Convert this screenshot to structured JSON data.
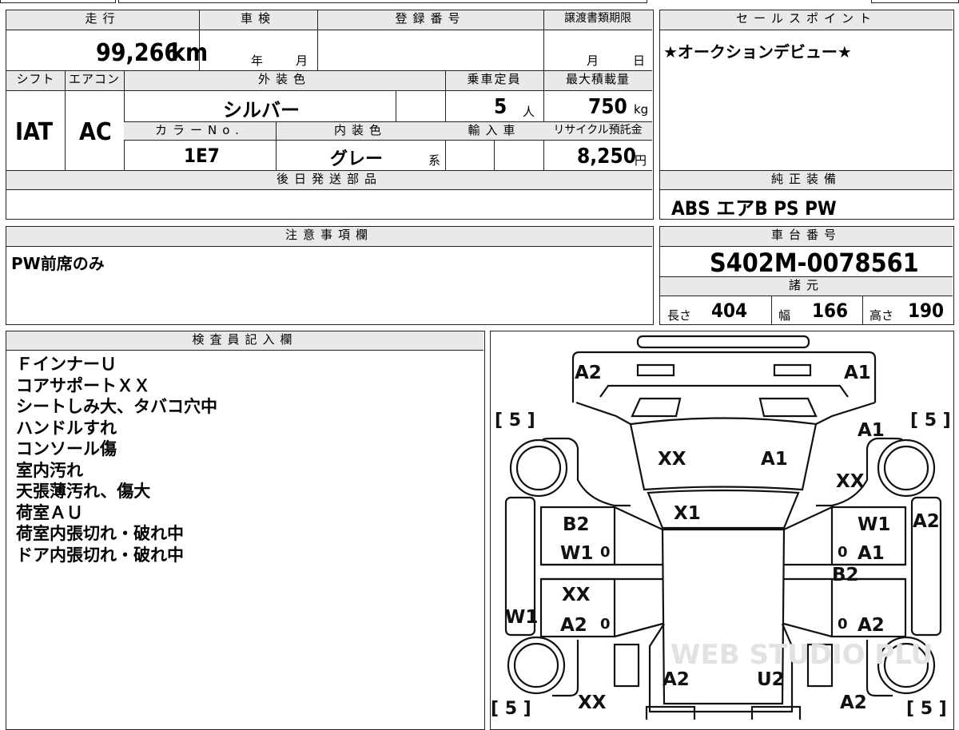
{
  "sheet": {
    "mileage": {
      "header": "走行",
      "value": "99,266",
      "unit": "km"
    },
    "shaken": {
      "header": "車検",
      "year": "年",
      "month": "月"
    },
    "reg_no": {
      "header": "登録番号",
      "value": ""
    },
    "transfer_deadline": {
      "header": "譲渡書類期限",
      "month": "月",
      "day": "日"
    },
    "shift": {
      "header": "シフト",
      "value": "IAT"
    },
    "aircon": {
      "header": "エアコン",
      "value": "AC"
    },
    "exterior_color": {
      "header": "外装色",
      "value": "シルバー"
    },
    "capacity": {
      "header": "乗車定員",
      "value": "5",
      "unit": "人"
    },
    "max_load": {
      "header": "最大積載量",
      "value": "750",
      "unit": "kg"
    },
    "color_no": {
      "header": "カラーNo.",
      "value": "1E7"
    },
    "interior_color": {
      "header": "内装色",
      "value": "グレー",
      "suffix": "系"
    },
    "imported": {
      "header": "輸入車",
      "value": ""
    },
    "recycle_fee": {
      "header": "リサイクル預託金",
      "value": "8,250",
      "unit": "円"
    },
    "later_parts": {
      "header": "後日発送部品",
      "value": ""
    }
  },
  "sales_point": {
    "header": "セールスポイント",
    "text": "★オークションデビュー★"
  },
  "equipment": {
    "header": "純正装備",
    "text": "ABS エアB PS PW"
  },
  "notes": {
    "header": "注意事項欄",
    "text": "PW前席のみ"
  },
  "chassis": {
    "header": "車台番号",
    "value": "S402M-0078561"
  },
  "specs": {
    "header": "諸元",
    "length_label": "長さ",
    "length": "404",
    "width_label": "幅",
    "width": "166",
    "height_label": "高さ",
    "height": "190"
  },
  "inspector": {
    "header": "検査員記入欄",
    "lines": [
      "ＦインナーＵ",
      "コアサポートＸＸ",
      "シートしみ大、タバコ穴中",
      "ハンドルすれ",
      "コンソール傷",
      "室内汚れ",
      "天張薄汚れ、傷大",
      "荷室ＡＵ",
      "荷室内張切れ・破れ中",
      "ドア内張切れ・破れ中"
    ]
  },
  "diagram": {
    "tires": [
      "[ 5 ]",
      "[ 5 ]",
      "[ 5 ]",
      "[ 5 ]"
    ],
    "marks": {
      "front_left": "A2",
      "front_right": "A1",
      "hood_left": "XX",
      "hood_right": "A1",
      "fender_right_top": "A1",
      "fender_right": "XX",
      "windshield": "X1",
      "front_door_left_1": "B2",
      "front_door_left_2": "W1",
      "front_door_right_1": "W1",
      "front_door_right_2": "A1",
      "pillar_right": "B2",
      "side_right": "A2",
      "rear_door_left_1": "XX",
      "rear_door_left_2": "A2",
      "rear_door_right": "A2",
      "side_left": "W1",
      "roof_left": "A2",
      "roof_right": "U2",
      "rear_left": "XX",
      "rear_right": "A2"
    },
    "zero_marks": [
      "0",
      "0",
      "0",
      "0"
    ],
    "watermark": "WEB STUDIO PLU"
  }
}
